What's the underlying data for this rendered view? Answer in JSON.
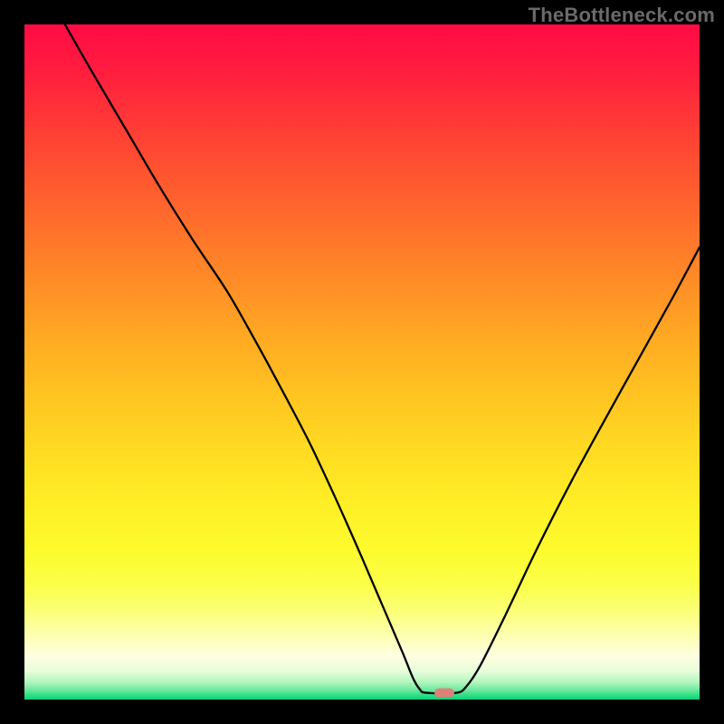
{
  "watermark": "TheBottleneck.com",
  "colors": {
    "frame": "#000000",
    "curve": "#000000",
    "marker": "#dd8078",
    "gradient_stops": [
      {
        "offset": 0.0,
        "color": "#ff0b45"
      },
      {
        "offset": 0.06,
        "color": "#ff1a3f"
      },
      {
        "offset": 0.14,
        "color": "#ff3736"
      },
      {
        "offset": 0.22,
        "color": "#ff5430"
      },
      {
        "offset": 0.3,
        "color": "#ff702b"
      },
      {
        "offset": 0.38,
        "color": "#ff8c27"
      },
      {
        "offset": 0.46,
        "color": "#ffa823"
      },
      {
        "offset": 0.54,
        "color": "#ffc121"
      },
      {
        "offset": 0.62,
        "color": "#ffd822"
      },
      {
        "offset": 0.7,
        "color": "#ffec25"
      },
      {
        "offset": 0.78,
        "color": "#fcfb2e"
      },
      {
        "offset": 0.83,
        "color": "#fbff48"
      },
      {
        "offset": 0.87,
        "color": "#fbff78"
      },
      {
        "offset": 0.905,
        "color": "#fdffb0"
      },
      {
        "offset": 0.935,
        "color": "#feffe0"
      },
      {
        "offset": 0.958,
        "color": "#e8fddb"
      },
      {
        "offset": 0.974,
        "color": "#b3f6bf"
      },
      {
        "offset": 0.986,
        "color": "#6ae99d"
      },
      {
        "offset": 0.994,
        "color": "#2fdd86"
      },
      {
        "offset": 1.0,
        "color": "#0ad177"
      }
    ]
  },
  "chart_data": {
    "type": "line",
    "title": "",
    "xlabel": "",
    "ylabel": "",
    "xlim": [
      0,
      100
    ],
    "ylim": [
      0,
      100
    ],
    "marker": {
      "x": 62.2,
      "y": 1.0
    },
    "series": [
      {
        "name": "bottleneck-curve",
        "points": [
          {
            "x": 6.0,
            "y": 100.0
          },
          {
            "x": 10.0,
            "y": 93.0
          },
          {
            "x": 15.0,
            "y": 84.5
          },
          {
            "x": 20.0,
            "y": 76.0
          },
          {
            "x": 25.0,
            "y": 68.0
          },
          {
            "x": 30.0,
            "y": 60.5
          },
          {
            "x": 34.0,
            "y": 53.5
          },
          {
            "x": 37.0,
            "y": 48.0
          },
          {
            "x": 42.0,
            "y": 38.5
          },
          {
            "x": 46.0,
            "y": 30.0
          },
          {
            "x": 50.0,
            "y": 21.0
          },
          {
            "x": 53.0,
            "y": 14.0
          },
          {
            "x": 56.0,
            "y": 7.0
          },
          {
            "x": 57.5,
            "y": 3.3
          },
          {
            "x": 58.5,
            "y": 1.6
          },
          {
            "x": 59.5,
            "y": 1.0
          },
          {
            "x": 64.0,
            "y": 1.0
          },
          {
            "x": 65.5,
            "y": 2.0
          },
          {
            "x": 67.5,
            "y": 5.0
          },
          {
            "x": 71.0,
            "y": 12.0
          },
          {
            "x": 76.0,
            "y": 22.5
          },
          {
            "x": 81.0,
            "y": 32.3
          },
          {
            "x": 86.0,
            "y": 41.5
          },
          {
            "x": 91.0,
            "y": 50.5
          },
          {
            "x": 96.0,
            "y": 59.5
          },
          {
            "x": 100.0,
            "y": 67.0
          }
        ]
      }
    ]
  }
}
